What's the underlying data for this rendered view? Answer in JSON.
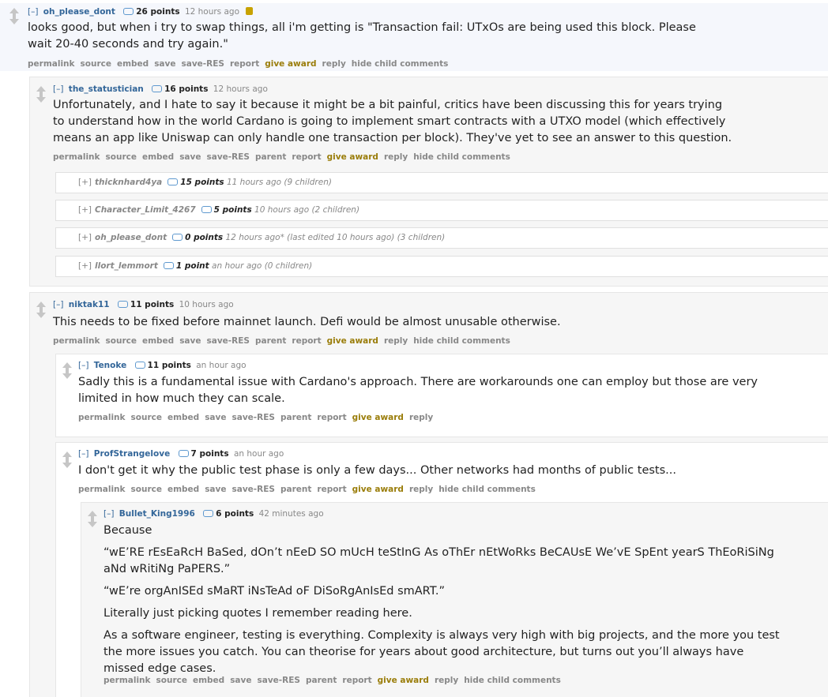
{
  "comments": {
    "c1": {
      "toggle": "[–]",
      "author": "oh_please_dont",
      "points": "26 points",
      "time": "12 hours ago",
      "lines": [
        "looks good, but when i try to swap things, all i'm getting is \"Transaction fail: UTxOs are being used this block. Please",
        "wait 20-40 seconds and try again.\""
      ],
      "buttons": [
        "permalink",
        "source",
        "embed",
        "save",
        "save-RES",
        "report",
        "give award",
        "reply",
        "hide child comments"
      ]
    },
    "c2": {
      "toggle": "[–]",
      "author": "the_statustician",
      "points": "16 points",
      "time": "12 hours ago",
      "lines": [
        "Unfortunately, and I hate to say it because it might be a bit painful, critics have been discussing this for years trying",
        "to understand how in the world Cardano is going to implement smart contracts with a UTXO model (which effectively",
        "means an app like Uniswap can only handle one transaction per block). They've yet to see an answer to this question."
      ],
      "buttons": [
        "permalink",
        "source",
        "embed",
        "save",
        "save-RES",
        "parent",
        "report",
        "give award",
        "reply",
        "hide child comments"
      ]
    },
    "collapsed": [
      {
        "toggle": "[+]",
        "author": "thicknhard4ya",
        "points": "15 points",
        "meta": "11 hours ago (9 children)"
      },
      {
        "toggle": "[+]",
        "author": "Character_Limit_4267",
        "points": "5 points",
        "meta": "10 hours ago (2 children)"
      },
      {
        "toggle": "[+]",
        "author": "oh_please_dont",
        "points": "0 points",
        "meta": "12 hours ago* (last edited 10 hours ago) (3 children)"
      },
      {
        "toggle": "[+]",
        "author": "llort_lemmort",
        "points": "1 point",
        "meta": "an hour ago (0 children)"
      }
    ],
    "c3": {
      "toggle": "[–]",
      "author": "niktak11",
      "points": "11 points",
      "time": "10 hours ago",
      "lines": [
        "This needs to be fixed before mainnet launch. Defi would be almost unusable otherwise."
      ],
      "buttons": [
        "permalink",
        "source",
        "embed",
        "save",
        "save-RES",
        "parent",
        "report",
        "give award",
        "reply",
        "hide child comments"
      ]
    },
    "c4": {
      "toggle": "[–]",
      "author": "Tenoke",
      "points": "11 points",
      "time": "an hour ago",
      "lines": [
        "Sadly this is a fundamental issue with Cardano's approach. There are workarounds one can employ but those are very",
        "limited in how much they can scale."
      ],
      "buttons": [
        "permalink",
        "source",
        "embed",
        "save",
        "save-RES",
        "parent",
        "report",
        "give award",
        "reply"
      ]
    },
    "c5": {
      "toggle": "[–]",
      "author": "ProfStrangelove",
      "points": "7 points",
      "time": "an hour ago",
      "lines": [
        "I don't get it why the public test phase is only a few days... Other networks had months of public tests..."
      ],
      "buttons": [
        "permalink",
        "source",
        "embed",
        "save",
        "save-RES",
        "parent",
        "report",
        "give award",
        "reply",
        "hide child comments"
      ]
    },
    "c6": {
      "toggle": "[–]",
      "author": "Bullet_King1996",
      "points": "6 points",
      "time": "42 minutes ago",
      "paragraphs": [
        [
          "Because"
        ],
        [
          "“wE’RE rEsEaRcH BaSed, dOn’t nEeD SO mUcH teStInG As oThEr nEtWoRks BeCAUsE We’vE SpEnt yearS ThEoRiSiNg",
          "aNd wRitiNg PaPERS.”"
        ],
        [
          "“wE’re orgAnISEd sMaRT iNsTeAd oF DiSoRgAnIsEd smART.”"
        ],
        [
          "Literally just picking quotes I remember reading here."
        ],
        [
          "As a software engineer, testing is everything. Complexity is always very high with big projects, and the more you test",
          "the more issues you catch. You can theorise for years about good architecture, but turns out you’ll always have",
          "missed edge cases."
        ]
      ],
      "buttons": [
        "permalink",
        "source",
        "embed",
        "save",
        "save-RES",
        "parent",
        "report",
        "give award",
        "reply",
        "hide child comments"
      ]
    }
  }
}
